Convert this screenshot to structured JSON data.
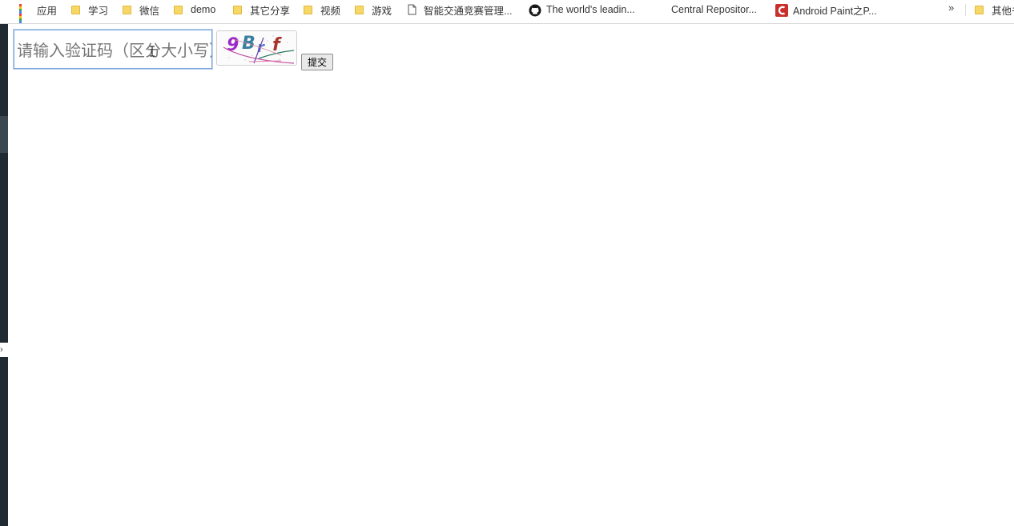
{
  "bookmarks": [
    {
      "label": "应用",
      "icon": "apps-grid-icon"
    },
    {
      "label": "学习",
      "icon": "folder-icon"
    },
    {
      "label": "微信",
      "icon": "folder-icon"
    },
    {
      "label": "demo",
      "icon": "folder-icon"
    },
    {
      "label": "其它分享",
      "icon": "folder-icon"
    },
    {
      "label": "视频",
      "icon": "folder-icon"
    },
    {
      "label": "游戏",
      "icon": "folder-icon"
    },
    {
      "label": "智能交通竞赛管理...",
      "icon": "page-icon"
    },
    {
      "label": "The world's leadin...",
      "icon": "github-icon"
    },
    {
      "label": "Central Repositor...",
      "icon": "none"
    },
    {
      "label": "Android Paint之P...",
      "icon": "csdn-icon"
    },
    {
      "label": "其他书",
      "icon": "folder-icon"
    }
  ],
  "more_label": "»",
  "form": {
    "captcha_placeholder": "请输入验证码（区分大小写）",
    "captcha_value": "",
    "captcha_image_text": "9Brf",
    "submit_label": "提交"
  },
  "colors": {
    "folder": "#f7d766",
    "focus_border": "#7aa5d8",
    "csdn_red": "#c9302c"
  }
}
